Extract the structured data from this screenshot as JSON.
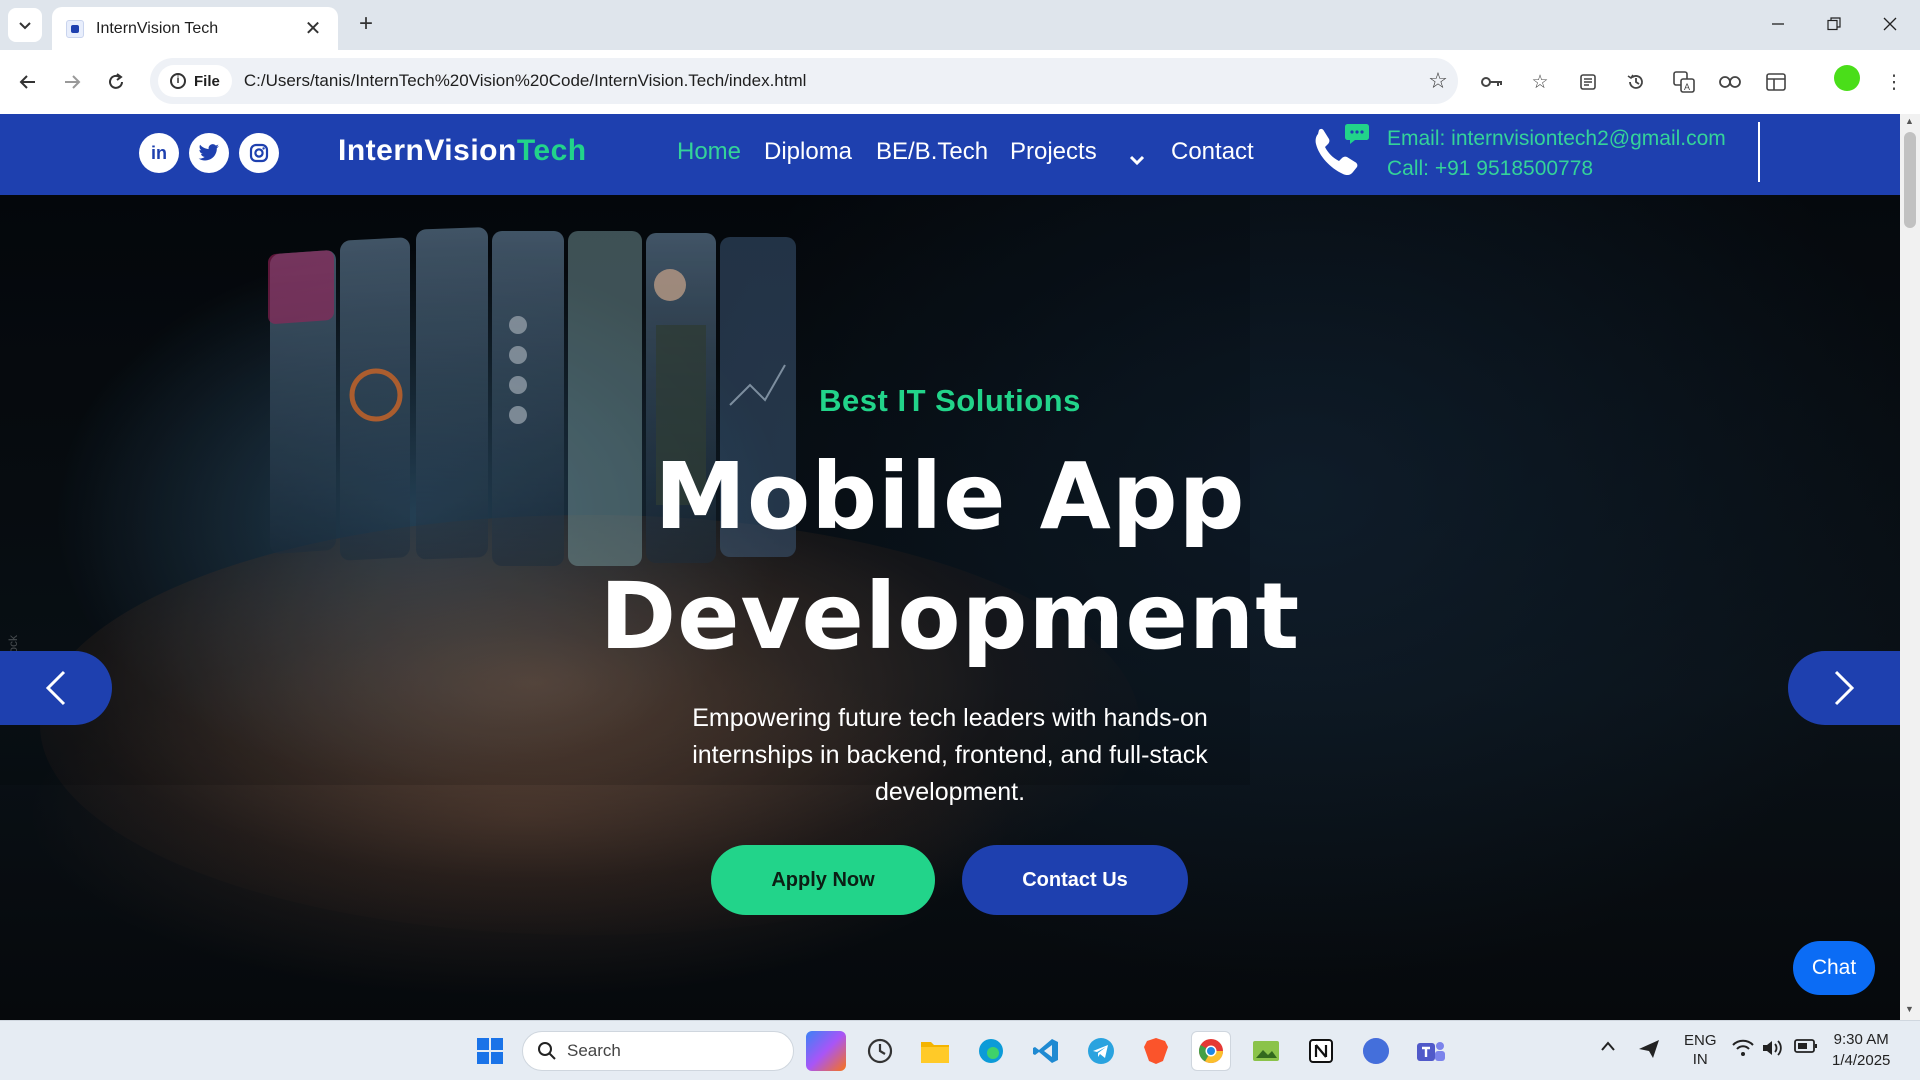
{
  "browser": {
    "tab_title": "InternVision Tech",
    "new_tab": "+",
    "site_chip": "File",
    "url": "C:/Users/tanis/InternTech%20Vision%20Code/InternVision.Tech/index.html"
  },
  "header": {
    "brand_part1": "InternVision",
    "brand_part2": "Tech",
    "nav": {
      "home": "Home",
      "diploma": "Diploma",
      "betech": "BE/B.Tech",
      "projects": "Projects",
      "contact": "Contact"
    },
    "email": "Email: internvisiontech2@gmail.com",
    "call": "Call: +91 9518500778"
  },
  "hero": {
    "kicker": "Best IT Solutions",
    "title_line1": "Mobile App",
    "title_line2": "Development",
    "subtitle": "Empowering future tech leaders with hands-on internships in backend, frontend, and full-stack development.",
    "apply_label": "Apply Now",
    "contact_label": "Contact Us",
    "chat_label": "Chat"
  },
  "taskbar": {
    "search_placeholder": "Search",
    "lang_top": "ENG",
    "lang_bottom": "IN",
    "time": "9:30 AM",
    "date": "1/4/2025"
  },
  "colors": {
    "brand_blue": "#1e40af",
    "accent_green": "#22d48a",
    "chat_blue": "#0b6cf5"
  }
}
